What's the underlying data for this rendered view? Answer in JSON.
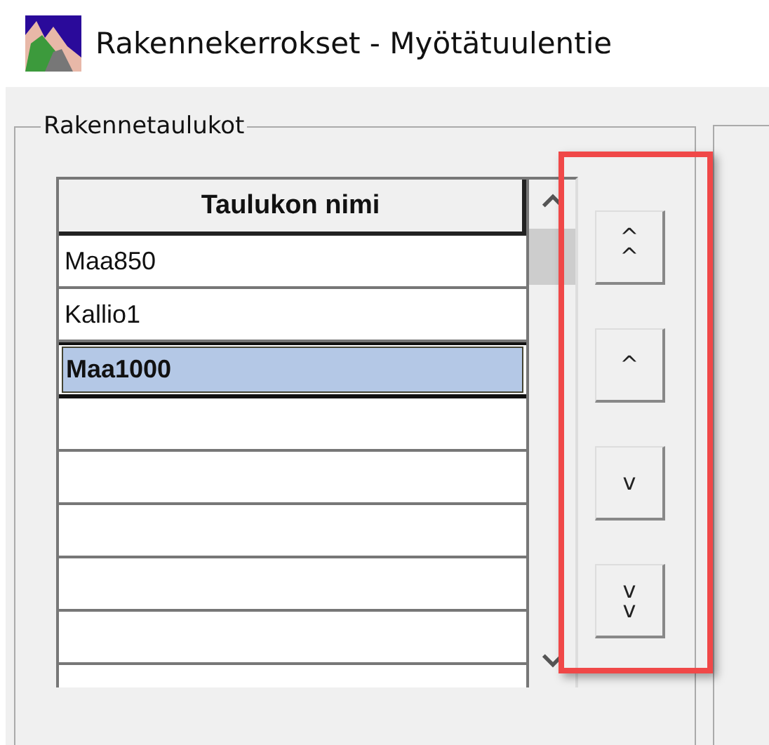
{
  "window": {
    "title": "Rakennekerrokset - Myötätuulentie"
  },
  "group": {
    "title": "Rakennetaulukot",
    "table": {
      "columns": [
        "Taulukon nimi"
      ],
      "rows": [
        {
          "name": "Maa850",
          "selected": false
        },
        {
          "name": "Kallio1",
          "selected": false
        },
        {
          "name": "Maa1000",
          "selected": true
        }
      ]
    },
    "move_buttons": {
      "highlighted": true,
      "buttons": [
        {
          "label": "^\n^"
        },
        {
          "label": "^"
        },
        {
          "label": "v"
        },
        {
          "label": "v\nv"
        }
      ]
    }
  }
}
